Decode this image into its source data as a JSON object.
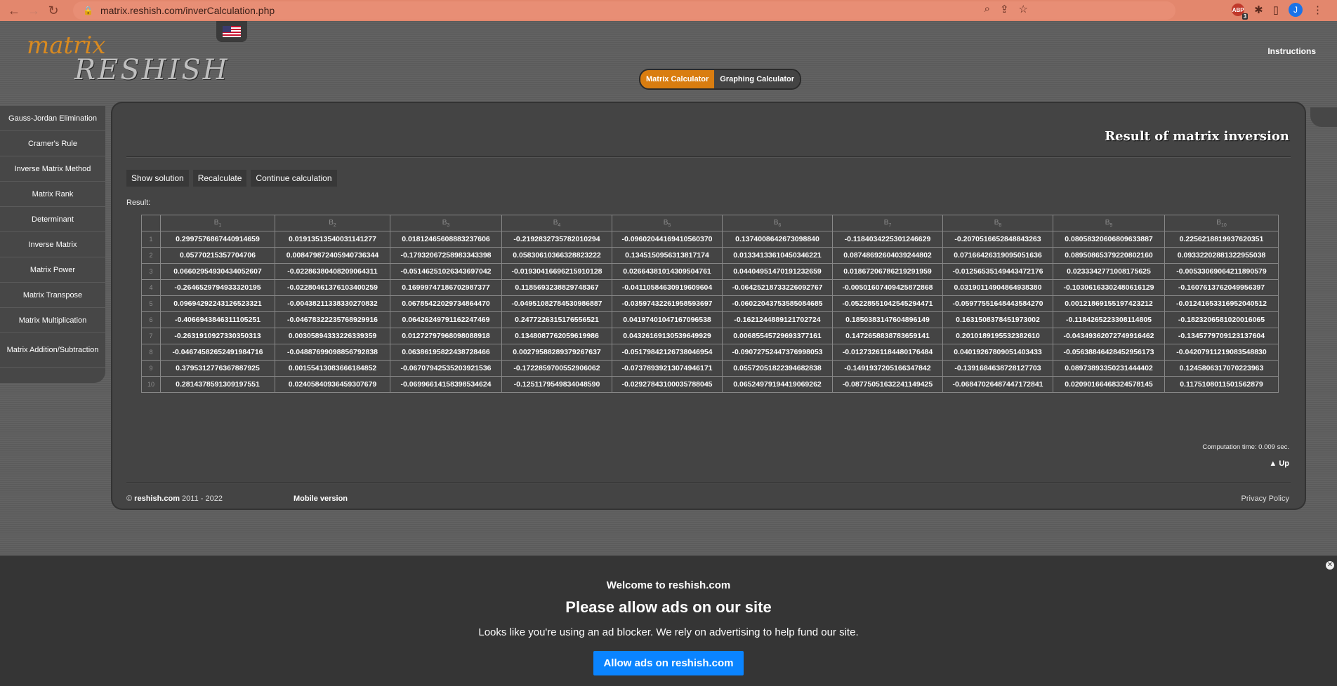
{
  "browser": {
    "url": "matrix.reshish.com/inverCalculation.php",
    "abp_label": "ABP",
    "abp_count": "3",
    "profile_initial": "J"
  },
  "header": {
    "logo_top": "matrix",
    "logo_bottom": "RESHISH",
    "instructions": "Instructions",
    "calc_tabs": [
      "Matrix Calculator",
      "Graphing Calculator"
    ]
  },
  "sidebar": {
    "items": [
      "Gauss-Jordan Elimination",
      "Cramer's Rule",
      "Inverse Matrix Method",
      "Matrix Rank",
      "Determinant",
      "Inverse Matrix",
      "Matrix Power",
      "Matrix Transpose",
      "Matrix Multiplication",
      "Matrix Addition/Subtraction"
    ]
  },
  "main": {
    "title": "Result of matrix inversion",
    "buttons": [
      "Show solution",
      "Recalculate",
      "Continue calculation"
    ],
    "result_label": "Result:",
    "computation_time": "Computation time: 0.009 sec.",
    "up_label": "▲ Up"
  },
  "matrix": {
    "headers": [
      "B1",
      "B2",
      "B3",
      "B4",
      "B5",
      "B6",
      "B7",
      "B8",
      "B9",
      "B10"
    ],
    "header_base": "B",
    "header_subs": [
      "1",
      "2",
      "3",
      "4",
      "5",
      "6",
      "7",
      "8",
      "9",
      "10"
    ],
    "rows": [
      [
        "0.2997576867440914659",
        "0.01913513540031141277",
        "0.01812465608883237606",
        "-0.2192832735782010294",
        "-0.09602044169410560370",
        "0.1374008642673098840",
        "-0.1184034225301246629",
        "-0.2070516652848843263",
        "0.08058320606809633887",
        "0.2256218819937620351"
      ],
      [
        "0.05770215357704706",
        "0.008479872405940736344",
        "-0.17932067258983343398",
        "0.05830610366328823222",
        "0.1345150956313817174",
        "0.01334133610450346221",
        "0.08748692604039244802",
        "0.07166426319095051636",
        "0.08950865379220802160",
        "0.09332202881322955038"
      ],
      [
        "0.06602954930434052607",
        "-0.02286380408209064311",
        "-0.05146251026343697042",
        "-0.01930416696215910128",
        "0.02664381014309504761",
        "0.04404951470191232659",
        "0.01867206786219291959",
        "-0.01256535149443472176",
        "0.0233342771008175625",
        "-0.00533069064211890579"
      ],
      [
        "-0.2646529794933320195",
        "-0.02280461376103400259",
        "0.16999747186702987377",
        "0.1185693238829748367",
        "-0.04110584630919609604",
        "-0.06425218733226092767",
        "-0.00501607409425872868",
        "0.03190114904864938380",
        "-0.10306163302480616129",
        "-0.1607613762049956397"
      ],
      [
        "0.09694292243126523321",
        "-0.00438211338330270832",
        "0.06785422029734864470",
        "-0.04951082784530986887",
        "-0.03597432261958593697",
        "-0.06022043753585084685",
        "-0.05228551042545294471",
        "-0.05977551648443584270",
        "0.00121869155197423212",
        "-0.01241653316952040512"
      ],
      [
        "-0.4066943846311105251",
        "-0.04678322235768929916",
        "0.06426249791162247469",
        "0.2477226315176556521",
        "0.04197401047167096538",
        "-0.1621244889121702724",
        "0.1850383147604896149",
        "0.1631508378451973002",
        "-0.1184265223308114805",
        "-0.1823206581020016065"
      ],
      [
        "-0.2631910927330350313",
        "0.00305894333226339359",
        "0.01272797968098088918",
        "0.1348087762059619986",
        "0.04326169130539649929",
        "0.00685545729693377161",
        "0.1472658838783659141",
        "0.2010189195532382610",
        "-0.04349362072749916462",
        "-0.1345779709123137604"
      ],
      [
        "-0.04674582652491984716",
        "-0.04887699098856792838",
        "0.06386195822438728466",
        "0.00279588289379267637",
        "-0.05179842126738046954",
        "-0.09072752447376998053",
        "-0.01273261184480176484",
        "0.04019267809051403433",
        "-0.05638846428452956173",
        "-0.04207911219083548830"
      ],
      [
        "0.3795312776367887925",
        "0.00155413083666184852",
        "-0.06707942535203921536",
        "-0.1722859700552906062",
        "-0.07378939213074946171",
        "0.05572051822394682838",
        "-0.1491937205166347842",
        "-0.1391684638728127703",
        "0.08973893350231444402",
        "0.1245806317070223963"
      ],
      [
        "0.2814378591309197551",
        "0.02405840936459307679",
        "-0.06996614158398534624",
        "-0.1251179549834048590",
        "-0.02927843100035788045",
        "0.06524979194419069262",
        "-0.08775051632241149425",
        "-0.06847026487447172841",
        "0.02090166468324578145",
        "0.1175108011501562879"
      ]
    ]
  },
  "footer": {
    "copy_brand": "reshish.com",
    "copy_years": "2011 - 2022",
    "copy_symbol": "©",
    "mobile": "Mobile version",
    "privacy": "Privacy Policy"
  },
  "ad": {
    "close": "✕",
    "welcome": "Welcome to reshish.com",
    "title": "Please allow ads on our site",
    "description": "Looks like you're using an ad blocker. We rely on advertising to help fund our site.",
    "button": "Allow ads on reshish.com"
  }
}
